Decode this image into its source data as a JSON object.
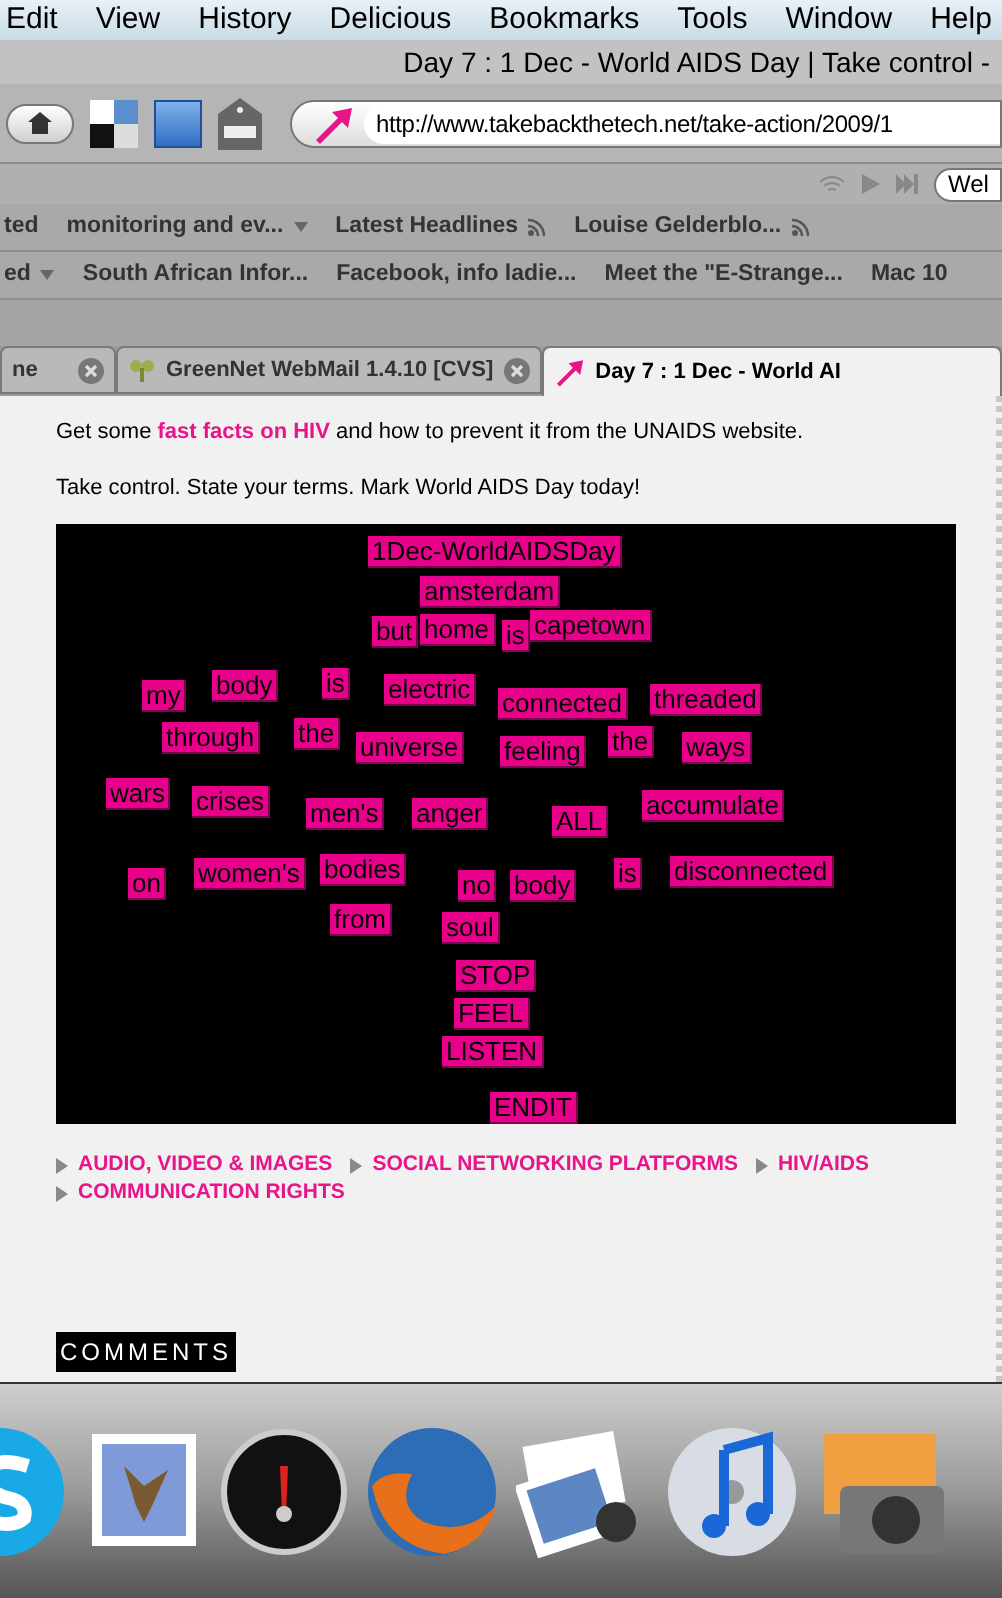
{
  "menu_bar": [
    "Edit",
    "View",
    "History",
    "Delicious",
    "Bookmarks",
    "Tools",
    "Window",
    "Help"
  ],
  "window": {
    "title": "Day 7 : 1 Dec - World AIDS Day | Take control -"
  },
  "address_bar": {
    "value": "http://www.takebackthetech.net/take-action/2009/1"
  },
  "search_field": {
    "value": "Wel"
  },
  "bookmarks_row_1": [
    {
      "label": "ted",
      "kind": "plain"
    },
    {
      "label": "monitoring and ev...",
      "kind": "folder"
    },
    {
      "label": "Latest Headlines",
      "kind": "feed"
    },
    {
      "label": "Louise Gelderblo...",
      "kind": "feed"
    }
  ],
  "bookmarks_row_2": [
    {
      "label": "ed",
      "kind": "folder"
    },
    {
      "label": "South African Infor...",
      "kind": "plain"
    },
    {
      "label": "Facebook, info ladie...",
      "kind": "plain"
    },
    {
      "label": "Meet the \"E-Strange...",
      "kind": "plain"
    },
    {
      "label": "Mac 10",
      "kind": "plain"
    }
  ],
  "tabs": [
    {
      "label": "ne",
      "selected": false
    },
    {
      "label": "GreenNet WebMail 1.4.10 [CVS]",
      "selected": false
    },
    {
      "label": "Day 7 : 1 Dec - World AI",
      "selected": true
    }
  ],
  "content": {
    "paragraphs": [
      "Get some **fast facts on HIV** and how to prevent it from the UNAIDS website.",
      "Take control. State your terms. Mark World AIDS Day today!"
    ],
    "poem_words": [
      "1Dec-WorldAIDSDay",
      "amsterdam",
      "but",
      "home",
      "is",
      "capetown",
      "my",
      "body",
      "is",
      "electric",
      "connected",
      "threaded",
      "through",
      "the",
      "universe",
      "feeling",
      "the",
      "ways",
      "wars",
      "crises",
      "men's",
      "anger",
      "ALL",
      "accumulate",
      "on",
      "women's",
      "bodies",
      "no",
      "body",
      "is",
      "disconnected",
      "from",
      "soul",
      "STOP",
      "FEEL",
      "LISTEN",
      "ENDIT"
    ],
    "tags": [
      "AUDIO, VIDEO & IMAGES",
      "SOCIAL NETWORKING PLATFORMS",
      "HIV/AIDS",
      "COMMUNICATION RIGHTS"
    ],
    "comments_heading": "COMMENTS"
  }
}
